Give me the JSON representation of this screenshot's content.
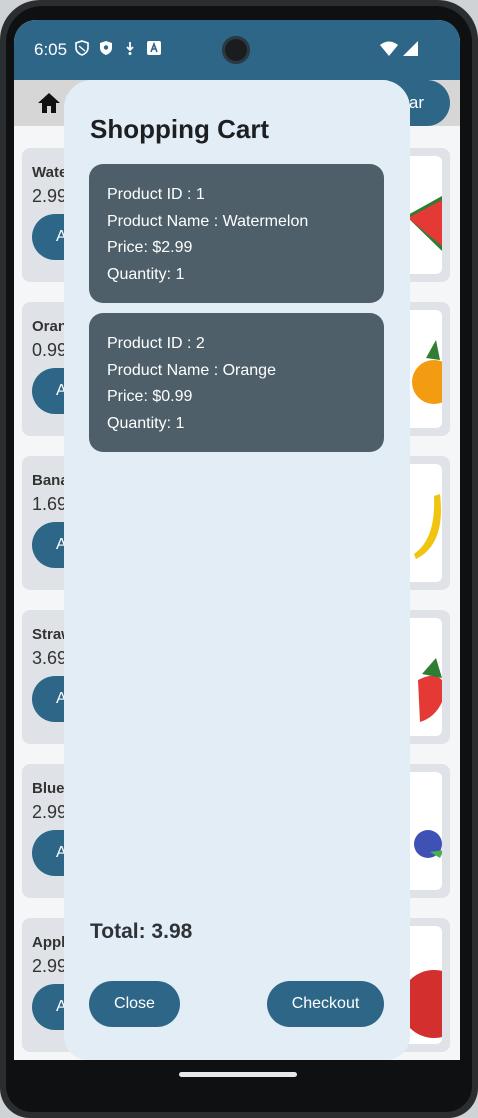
{
  "status_bar": {
    "time": "6:05",
    "icons": [
      "shield-outline-icon",
      "shield-filled-icon",
      "download-icon",
      "font-a-icon"
    ],
    "right_icons": [
      "wifi-icon",
      "signal-icon"
    ]
  },
  "toolbar": {
    "home_icon": "home-icon",
    "clear_label": "Clear"
  },
  "products": [
    {
      "name": "Watermelon",
      "price": "2.99",
      "add_label": "Add"
    },
    {
      "name": "Orange",
      "price": "0.99",
      "add_label": "Add"
    },
    {
      "name": "Banana",
      "price": "1.69",
      "add_label": "Add"
    },
    {
      "name": "Strawberry",
      "price": "3.69",
      "add_label": "Add"
    },
    {
      "name": "Blueberry",
      "price": "2.99",
      "add_label": "Add"
    },
    {
      "name": "Apple",
      "price": "2.99",
      "add_label": "Add"
    }
  ],
  "cart": {
    "title": "Shopping Cart",
    "items": [
      {
        "id_line": "Product ID : 1",
        "name_line": "Product Name : Watermelon",
        "price_line": "Price: $2.99",
        "qty_line": "Quantity: 1"
      },
      {
        "id_line": "Product ID : 2",
        "name_line": "Product Name : Orange",
        "price_line": "Price: $0.99",
        "qty_line": "Quantity: 1"
      }
    ],
    "total_label": "Total: 3.98",
    "close_label": "Close",
    "checkout_label": "Checkout"
  },
  "colors": {
    "primary": "#2e6688",
    "item_card": "#4e5f69",
    "dialog_bg": "#e3edf5"
  }
}
